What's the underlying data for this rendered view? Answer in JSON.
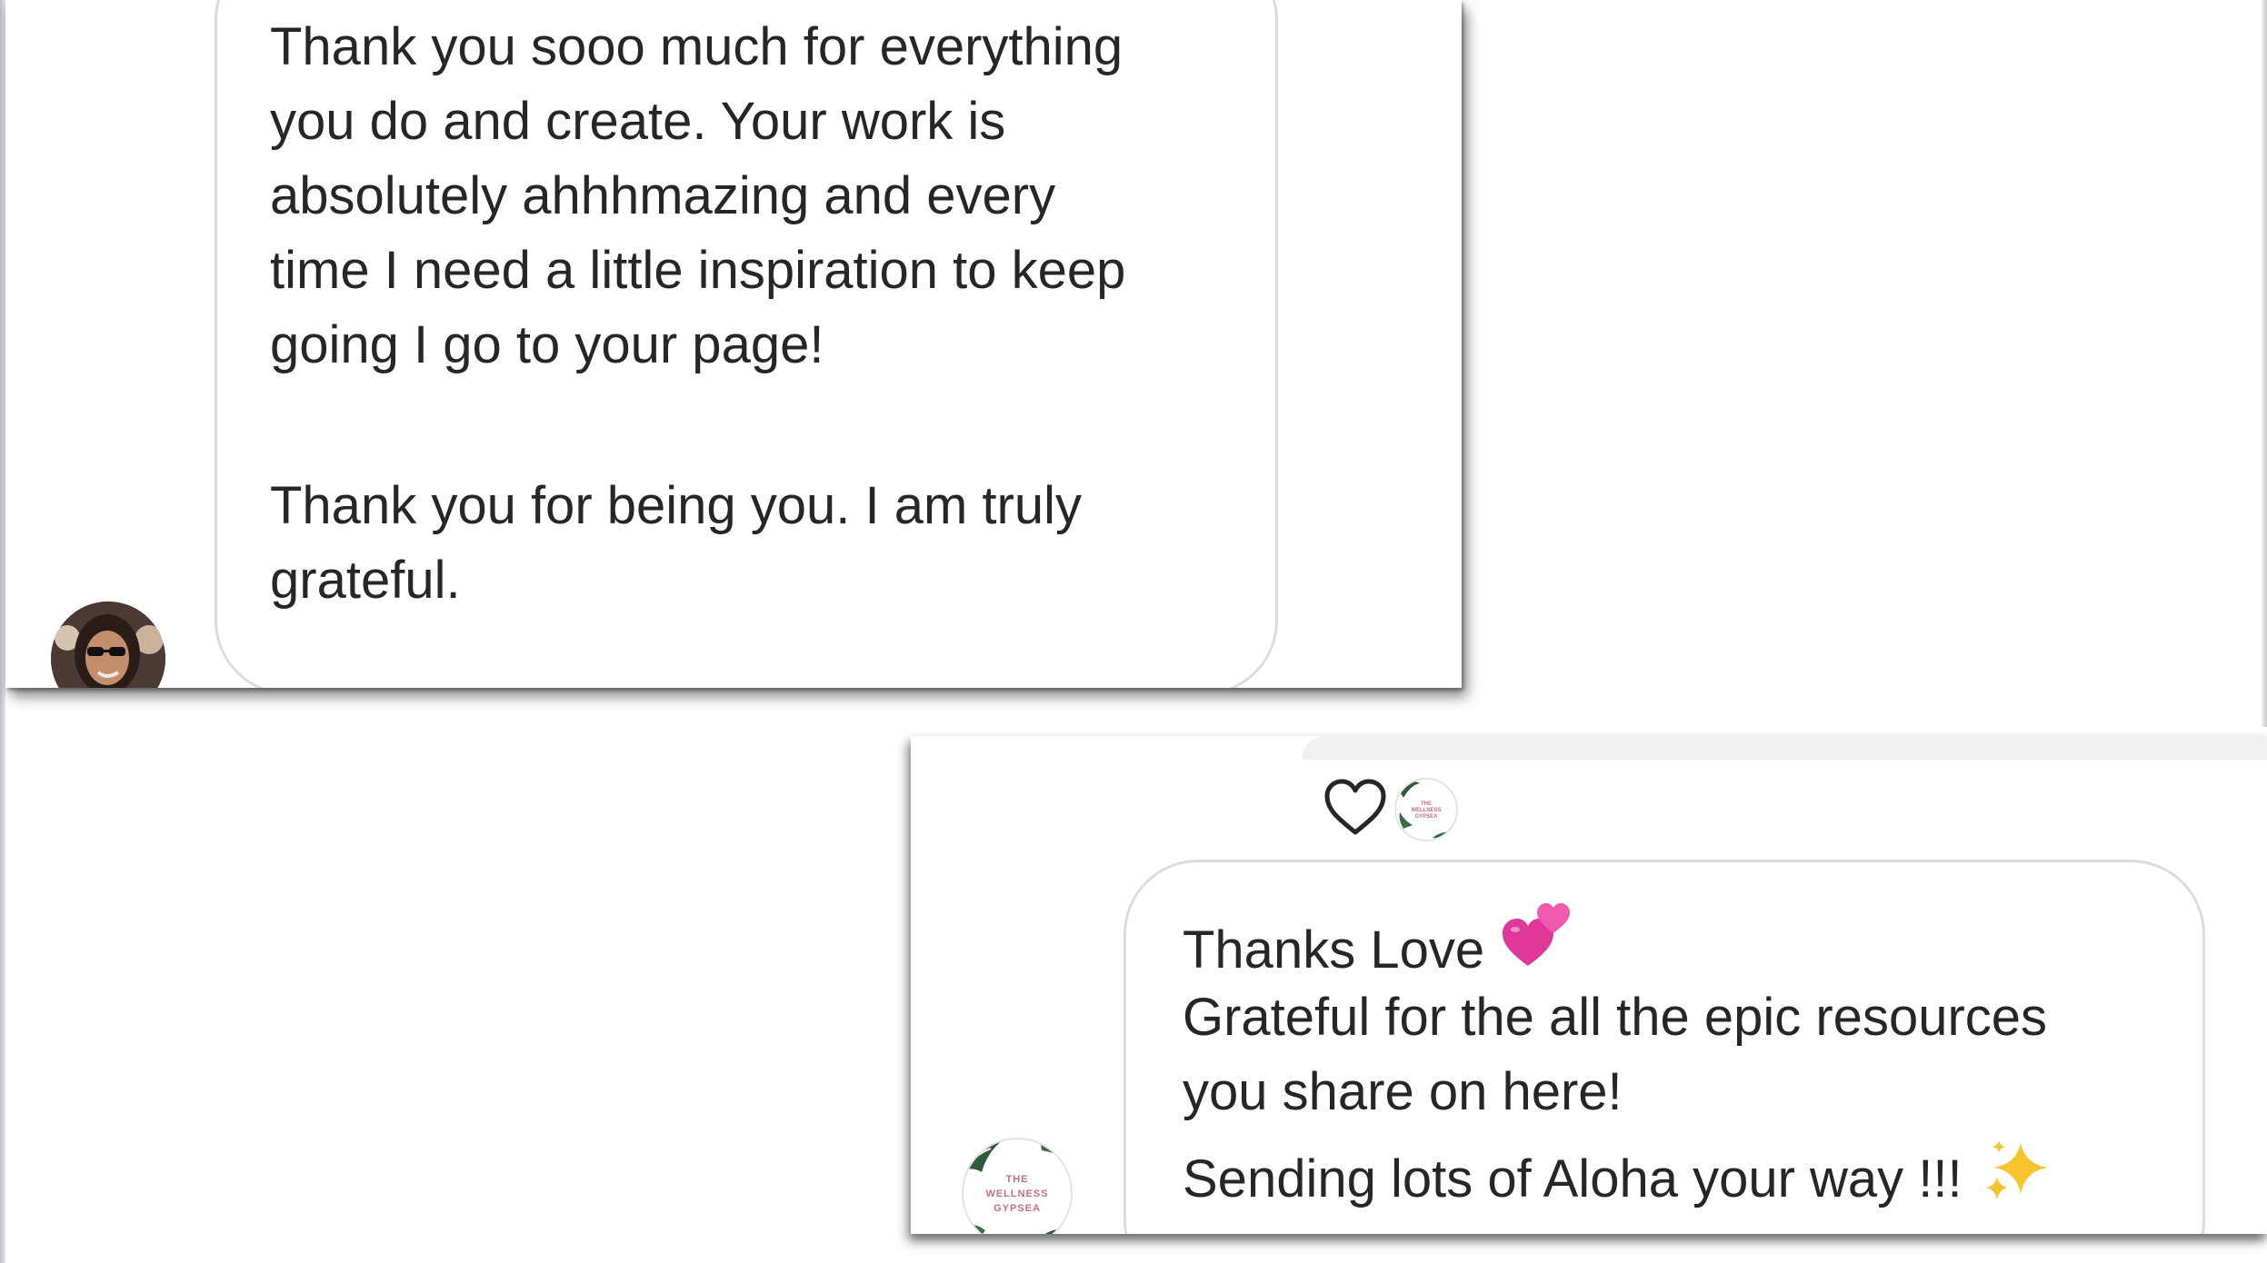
{
  "incoming_message": {
    "paragraph_1": "Thank you sooo much for everything\nyou do and create. Your work is\nabsolutely ahhhmazing and every\ntime I need a little inspiration to keep\ngoing I go to your page!",
    "paragraph_2": "Thank you for being you. I am truly\ngrateful.",
    "sender_avatar": "woman-with-sunglasses-avatar"
  },
  "reply_message": {
    "reaction": "heart-icon",
    "line_1": "Thanks Love",
    "line_1_emoji": "two-hearts-emoji",
    "line_2": "Grateful for the all the epic resources",
    "line_3": "you share on here!",
    "line_4": "Sending lots of Aloha your way !!!",
    "line_4_emoji": "sparkles-emoji",
    "brand_logo": {
      "line_1": "THE",
      "line_2": "WELLNESS",
      "line_3": "GYPSEA"
    }
  },
  "colors": {
    "text": "#262626",
    "bubble_border": "#dcdcdc",
    "emoji_pink": "#e0379b",
    "sparkle_yellow": "#f7c52b",
    "brand_pink": "#c4707c",
    "leaf_green": "#2f5a3a"
  }
}
